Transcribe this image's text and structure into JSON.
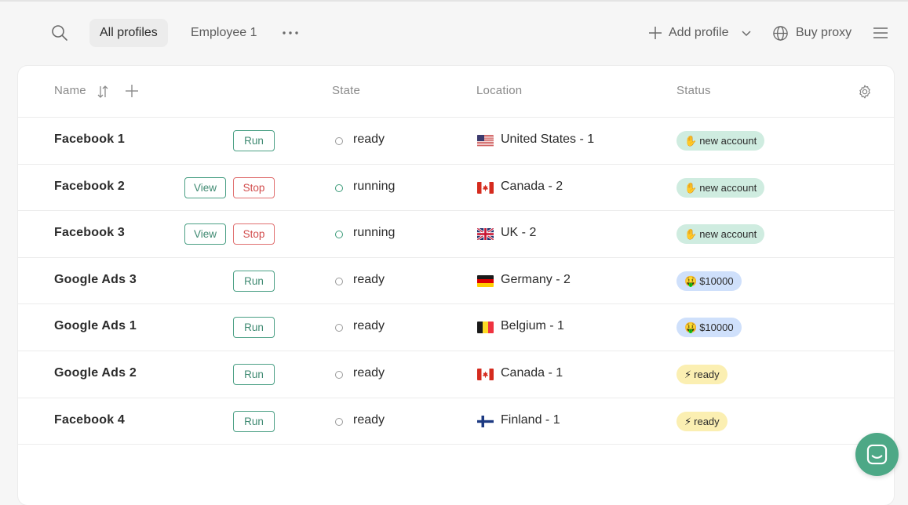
{
  "toolbar": {
    "tabs": [
      {
        "label": "All profiles",
        "active": true
      },
      {
        "label": "Employee 1",
        "active": false
      }
    ],
    "add_profile_label": "Add profile",
    "buy_proxy_label": "Buy proxy",
    "icons": {
      "search": "search-icon",
      "more": "more-dots-icon",
      "add": "plus-icon",
      "dropdown": "chevron-down-icon",
      "proxy": "globe-icon",
      "menu": "hamburger-menu-icon"
    }
  },
  "table": {
    "columns": {
      "name": "Name",
      "state": "State",
      "location": "Location",
      "status": "Status"
    },
    "rows": [
      {
        "name": "Facebook 1",
        "buttons": [
          "Run"
        ],
        "state": "ready",
        "flag": "us",
        "location": "United States - 1",
        "status": {
          "emoji": "✋",
          "label": "new account",
          "tone": "green"
        }
      },
      {
        "name": "Facebook 2",
        "buttons": [
          "View",
          "Stop"
        ],
        "state": "running",
        "flag": "ca",
        "location": "Canada - 2",
        "status": {
          "emoji": "✋",
          "label": "new account",
          "tone": "green"
        }
      },
      {
        "name": "Facebook 3",
        "buttons": [
          "View",
          "Stop"
        ],
        "state": "running",
        "flag": "uk",
        "location": "UK - 2",
        "status": {
          "emoji": "✋",
          "label": "new account",
          "tone": "green"
        }
      },
      {
        "name": "Google Ads 3",
        "buttons": [
          "Run"
        ],
        "state": "ready",
        "flag": "de",
        "location": "Germany - 2",
        "status": {
          "emoji": "🤑",
          "label": "$10000",
          "tone": "blue"
        }
      },
      {
        "name": "Google Ads 1",
        "buttons": [
          "Run"
        ],
        "state": "ready",
        "flag": "be",
        "location": "Belgium - 1",
        "status": {
          "emoji": "🤑",
          "label": "$10000",
          "tone": "blue"
        }
      },
      {
        "name": "Google Ads 2",
        "buttons": [
          "Run"
        ],
        "state": "ready",
        "flag": "ca",
        "location": "Canada - 1",
        "status": {
          "emoji": "⚡",
          "label": "ready",
          "tone": "yellow"
        }
      },
      {
        "name": "Facebook 4",
        "buttons": [
          "Run"
        ],
        "state": "ready",
        "flag": "fi",
        "location": "Finland - 1",
        "status": {
          "emoji": "⚡",
          "label": "ready",
          "tone": "yellow"
        }
      }
    ]
  },
  "colors": {
    "accent": "#4da886",
    "stop": "#d24c4c",
    "badge_green": "#cfece0",
    "badge_blue": "#cfe0fb",
    "badge_yellow": "#fbefb2"
  }
}
